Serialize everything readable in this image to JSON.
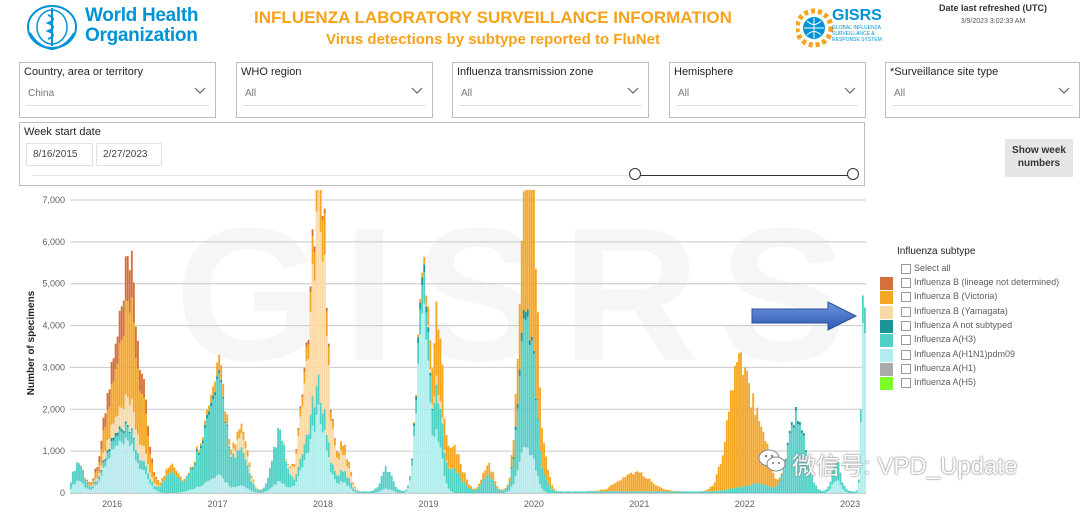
{
  "header": {
    "org_line1": "World Health",
    "org_line2": "Organization",
    "title": "INFLUENZA LABORATORY SURVEILLANCE INFORMATION",
    "subtitle": "Virus detections by subtype reported to FluNet",
    "gisrs_logo_text": "GISRS",
    "gisrs_logo_sub": [
      "GLOBAL INFLUENZA",
      "SURVEILLANCE &",
      "RESPONSE SYSTEM"
    ],
    "refresh_label": "Date last refreshed (UTC)",
    "refresh_value": "3/9/2023 3:02:33 AM"
  },
  "filters": [
    {
      "label": "Country, area or territory",
      "value": "China"
    },
    {
      "label": "WHO region",
      "value": "All"
    },
    {
      "label": "Influenza transmission zone",
      "value": "All"
    },
    {
      "label": "Hemisphere",
      "value": "All"
    },
    {
      "label": "*Surveillance site type",
      "value": "All"
    }
  ],
  "date_filter": {
    "label": "Week start date",
    "start": "8/16/2015",
    "end": "2/27/2023"
  },
  "week_button": {
    "line1": "Show week",
    "line2": "numbers"
  },
  "colors": {
    "b_lineage_nd": "#d4703a",
    "b_victoria": "#f5a623",
    "b_yamagata": "#f9d9a8",
    "a_not_subtyped": "#1a9494",
    "a_h3": "#4fd1c5",
    "a_h1n1": "#b3ecec",
    "a_h1": "#aaaaaa",
    "a_h5": "#7cfc2a",
    "accent": "#f7a21b",
    "who_blue": "#0093d5",
    "arrow": "#3f6ec6"
  },
  "legend": {
    "title": "Influenza subtype",
    "select_all": "Select all",
    "items": [
      {
        "label": "Influenza B (lineage not determined)",
        "color": "#d4703a"
      },
      {
        "label": "Influenza B (Victoria)",
        "color": "#f5a623"
      },
      {
        "label": "Influenza B (Yamagata)",
        "color": "#f9d9a8"
      },
      {
        "label": "Influenza A not subtyped",
        "color": "#1a9494"
      },
      {
        "label": "Influenza A(H3)",
        "color": "#4fd1c5"
      },
      {
        "label": "Influenza A(H1N1)pdm09",
        "color": "#b3ecec"
      },
      {
        "label": "Influenza A(H1)",
        "color": "#aaaaaa"
      },
      {
        "label": "Influenza A(H5)",
        "color": "#7cfc2a"
      }
    ]
  },
  "watermark": {
    "background": "GISRS",
    "wechat": "微信号: VPD_Update"
  },
  "chart_data": {
    "type": "bar",
    "stacked": true,
    "ylabel": "Number of specimens",
    "ylim": [
      0,
      7000
    ],
    "yticks": [
      "0",
      "1,000",
      "2,000",
      "3,000",
      "4,000",
      "5,000",
      "6,000",
      "7,000"
    ],
    "xticks": [
      "2016",
      "2017",
      "2018",
      "2019",
      "2020",
      "2021",
      "2022",
      "2023"
    ],
    "xrange": [
      2015.62,
      2023.17
    ],
    "grid": true,
    "series_order": [
      "a_h1n1",
      "a_h3",
      "a_not_subtyped",
      "b_yamagata",
      "b_victoria",
      "b_lineage_nd"
    ],
    "peaks": [
      {
        "x": 2015.7,
        "w": 0.05,
        "a_h1n1": 300,
        "a_h3": 400
      },
      {
        "x": 2016.05,
        "w": 0.1,
        "a_h1n1": 1000,
        "a_h3": 150,
        "a_not_subtyped": 80,
        "b_yamagata": 300,
        "b_victoria": 900,
        "b_lineage_nd": 500
      },
      {
        "x": 2016.2,
        "w": 0.07,
        "a_h1n1": 700,
        "a_h3": 200,
        "b_yamagata": 500,
        "b_victoria": 1800,
        "b_lineage_nd": 800
      },
      {
        "x": 2016.33,
        "w": 0.06,
        "a_h1n1": 300,
        "a_h3": 100,
        "b_yamagata": 200,
        "b_victoria": 600,
        "b_lineage_nd": 200
      },
      {
        "x": 2016.58,
        "w": 0.06,
        "a_h3": 500,
        "b_victoria": 200
      },
      {
        "x": 2016.95,
        "w": 0.12,
        "a_h3": 1300,
        "a_h1n1": 250,
        "a_not_subtyped": 80,
        "b_victoria": 100
      },
      {
        "x": 2017.05,
        "w": 0.06,
        "a_h3": 1100,
        "a_h1n1": 200,
        "b_victoria": 250
      },
      {
        "x": 2017.25,
        "w": 0.06,
        "a_h3": 700,
        "a_h1n1": 150,
        "b_yamagata": 300,
        "b_victoria": 200
      },
      {
        "x": 2017.6,
        "w": 0.06,
        "a_h3": 1100,
        "a_h1n1": 250
      },
      {
        "x": 2017.95,
        "w": 0.1,
        "a_h1n1": 1400,
        "a_h3": 600,
        "b_yamagata": 2600,
        "b_victoria": 500,
        "b_lineage_nd": 150
      },
      {
        "x": 2018.0,
        "w": 0.04,
        "a_h1n1": 600,
        "b_yamagata": 2300,
        "b_victoria": 800
      },
      {
        "x": 2018.22,
        "w": 0.05,
        "a_h1n1": 200,
        "a_h3": 200,
        "b_yamagata": 300,
        "b_victoria": 200
      },
      {
        "x": 2018.62,
        "w": 0.05,
        "a_h3": 450,
        "a_h1n1": 100
      },
      {
        "x": 2018.96,
        "w": 0.05,
        "a_h1n1": 4700,
        "a_h3": 700,
        "a_not_subtyped": 200,
        "b_victoria": 100
      },
      {
        "x": 2019.1,
        "w": 0.05,
        "a_h1n1": 1200,
        "a_h3": 800,
        "b_victoria": 1500,
        "b_yamagata": 200
      },
      {
        "x": 2019.25,
        "w": 0.08,
        "a_h3": 500,
        "b_victoria": 500
      },
      {
        "x": 2019.58,
        "w": 0.05,
        "a_h3": 400,
        "b_victoria": 250
      },
      {
        "x": 2019.92,
        "w": 0.06,
        "a_h3": 2400,
        "a_h1n1": 900,
        "a_not_subtyped": 200,
        "b_victoria": 1700
      },
      {
        "x": 2020.0,
        "w": 0.05,
        "a_h3": 1600,
        "a_h1n1": 500,
        "b_victoria": 3600
      },
      {
        "x": 2020.12,
        "w": 0.04,
        "a_h3": 200,
        "b_victoria": 400
      },
      {
        "x": 2020.97,
        "w": 0.14,
        "b_victoria": 450
      },
      {
        "x": 2021.95,
        "w": 0.1,
        "b_victoria": 2850,
        "a_h3": 80
      },
      {
        "x": 2022.15,
        "w": 0.08,
        "b_victoria": 1300,
        "a_h3": 200
      },
      {
        "x": 2022.5,
        "w": 0.08,
        "a_h3": 1800,
        "a_not_subtyped": 80
      },
      {
        "x": 2022.88,
        "w": 0.04,
        "a_h3": 400,
        "a_h1n1": 300
      },
      {
        "x": 2023.14,
        "w": 0.02,
        "a_h1n1": 4600,
        "a_h3": 700
      }
    ]
  }
}
